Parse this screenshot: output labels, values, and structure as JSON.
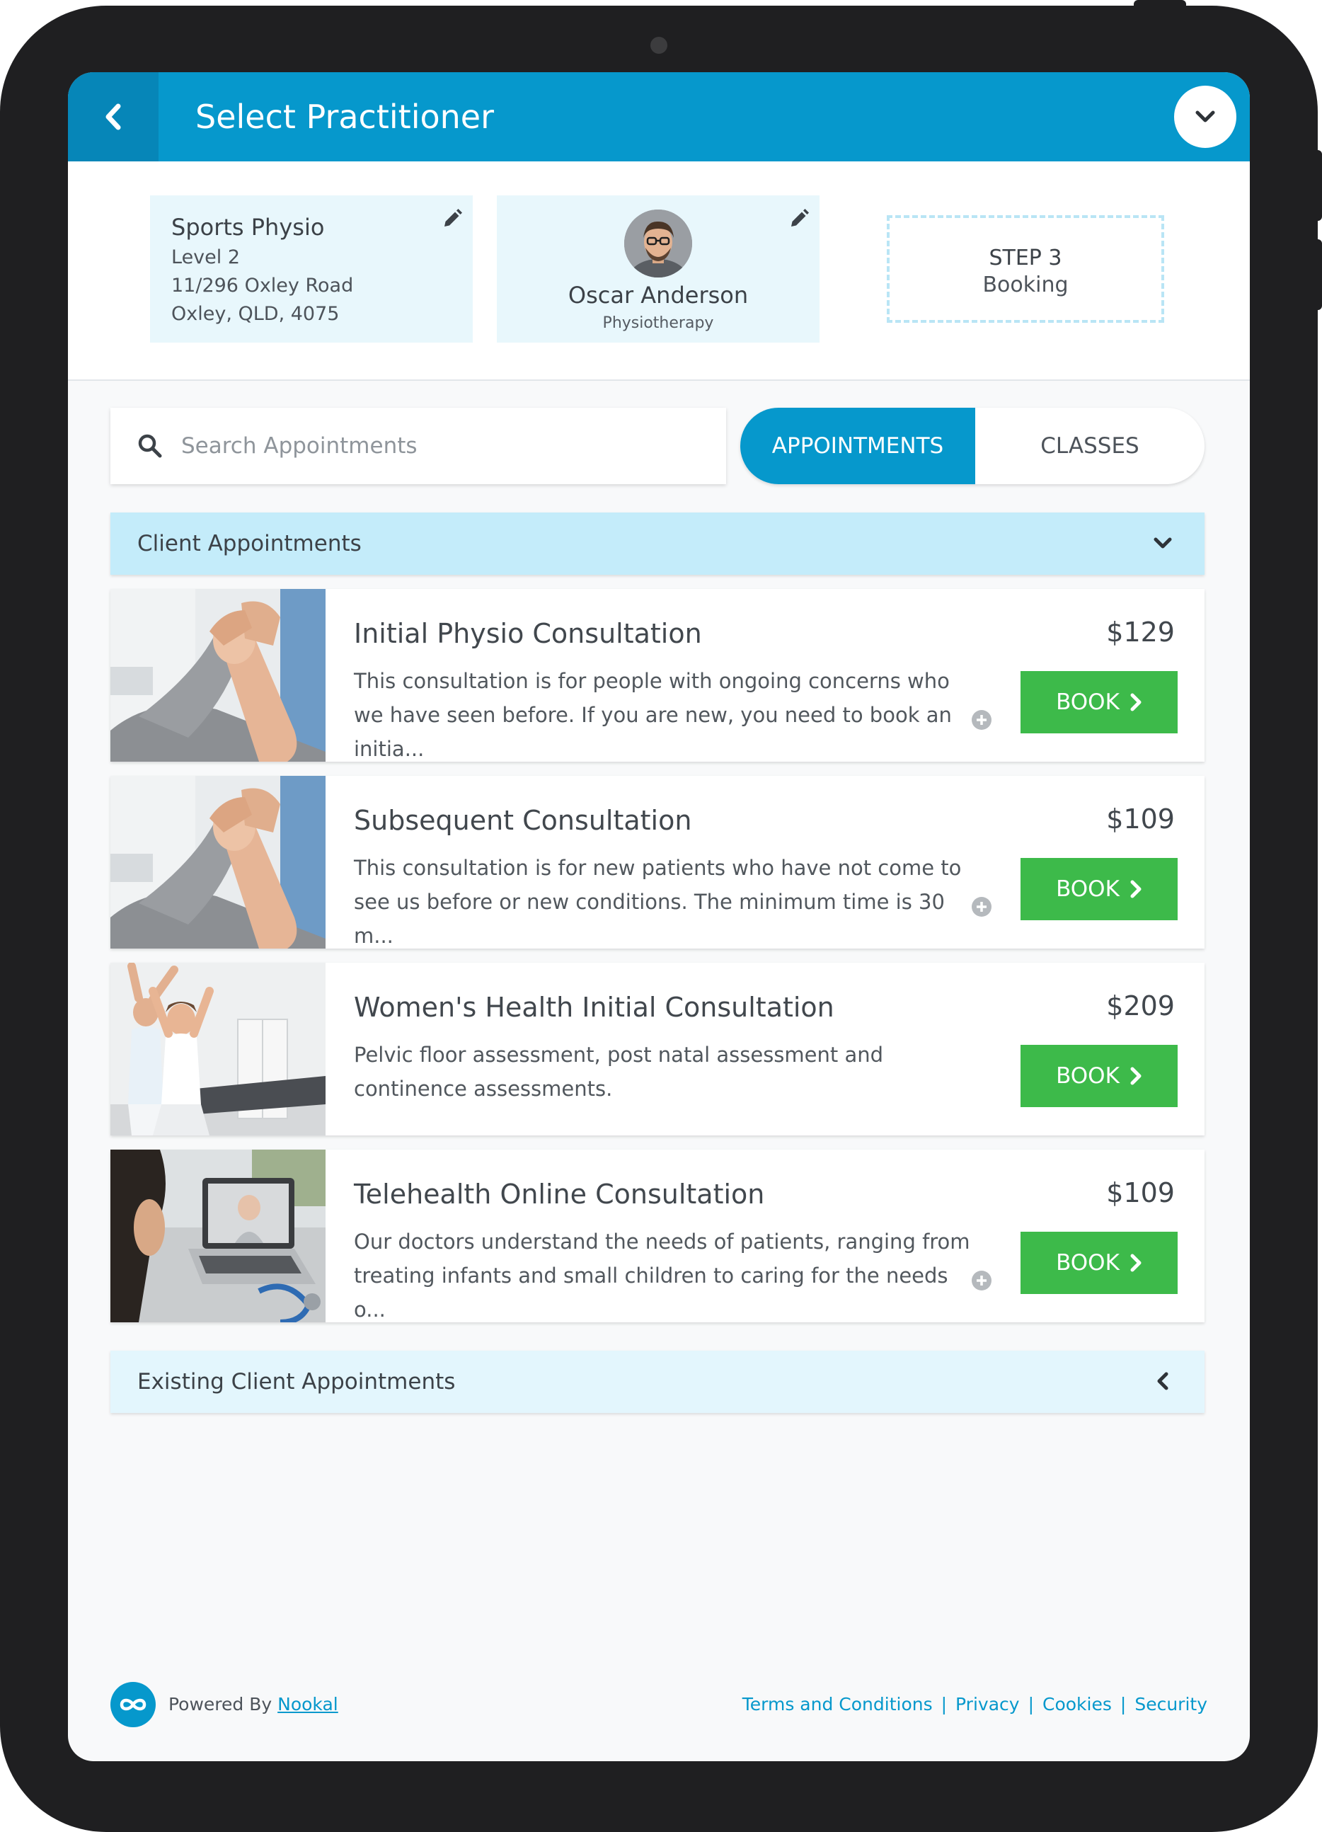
{
  "header": {
    "title": "Select Practitioner"
  },
  "location": {
    "name": "Sports Physio",
    "line1": "Level 2",
    "line2": "11/296 Oxley Road",
    "line3": "Oxley, QLD, 4075"
  },
  "practitioner": {
    "name": "Oscar Anderson",
    "specialty": "Physiotherapy"
  },
  "step": {
    "number": "STEP 3",
    "label": "Booking"
  },
  "search": {
    "placeholder": "Search Appointments"
  },
  "toggle": {
    "active": "APPOINTMENTS",
    "other": "CLASSES"
  },
  "groups": [
    {
      "title": "Client Appointments",
      "expanded": true
    },
    {
      "title": "Existing Client Appointments",
      "expanded": false
    }
  ],
  "appointments": [
    {
      "name": "Initial Physio Consultation",
      "price": "$129",
      "desc": "This consultation is for people with ongoing concerns who we have seen before. If you are new, you need to book an initia...",
      "button": "BOOK",
      "image": "physio-knee"
    },
    {
      "name": "Subsequent Consultation",
      "price": "$109",
      "desc": "This consultation is for new patients who have not come to see us before or new conditions. The minimum time is 30 m...",
      "button": "BOOK",
      "image": "physio-knee"
    },
    {
      "name": "Women's Health Initial Consultation",
      "price": "$209",
      "desc": "Pelvic floor assessment, post natal assessment and continence assessments.",
      "button": "BOOK",
      "image": "women-stretching"
    },
    {
      "name": "Telehealth Online Consultation",
      "price": "$109",
      "desc": "Our doctors understand the needs of patients, ranging from treating infants and small children to caring for the needs o...",
      "button": "BOOK",
      "image": "video-call-laptop"
    }
  ],
  "footer": {
    "powered_by": "Powered By ",
    "brand": "Nookal",
    "links": [
      "Terms and Conditions",
      "Privacy",
      "Cookies",
      "Security"
    ]
  },
  "colors": {
    "primary": "#0698cc",
    "primary_dark": "#0686b8",
    "book_green": "#3dba4a",
    "card_tint": "#e8f7fc",
    "group_header": "#c4ecfa",
    "group_header_collapsed": "#e3f6fd",
    "device_frame": "#1f1f21"
  }
}
